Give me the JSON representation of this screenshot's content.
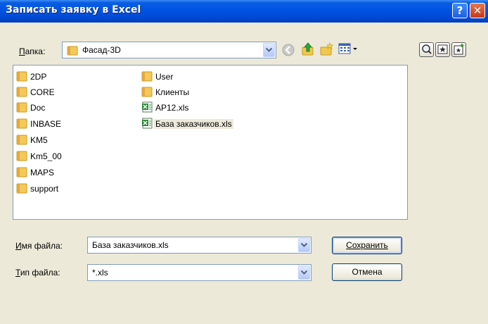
{
  "window": {
    "title": "Записать заявку в Excel",
    "help_glyph": "?",
    "close_glyph": "✕"
  },
  "toolbar": {
    "folder_label": "Папка:",
    "folder_label_accel": "П",
    "folder_label_rest": "апка:",
    "current_folder": "Фасад-3D",
    "icons": [
      "back-icon",
      "up-folder-icon",
      "new-folder-icon",
      "view-menu-icon"
    ]
  },
  "right_buttons": [
    "find-icon",
    "favorites-icon",
    "add-favorite-icon"
  ],
  "files": [
    {
      "name": "2DP",
      "type": "folder"
    },
    {
      "name": "CORE",
      "type": "folder"
    },
    {
      "name": "Doc",
      "type": "folder"
    },
    {
      "name": "INBASE",
      "type": "folder"
    },
    {
      "name": "KM5",
      "type": "folder"
    },
    {
      "name": "Km5_00",
      "type": "folder"
    },
    {
      "name": "MAPS",
      "type": "folder"
    },
    {
      "name": "support",
      "type": "folder"
    },
    {
      "name": "User",
      "type": "folder"
    },
    {
      "name": "Клиенты",
      "type": "folder"
    },
    {
      "name": "AP12.xls",
      "type": "excel"
    },
    {
      "name": "База заказчиков.xls",
      "type": "excel",
      "selected": true
    }
  ],
  "filename": {
    "label_accel": "И",
    "label_rest": "мя файла:",
    "value": "База заказчиков.xls"
  },
  "filetype": {
    "label_accel": "Т",
    "label_rest": "ип файла:",
    "value": "*.xls"
  },
  "buttons": {
    "save_label": "Сохранить",
    "cancel_label": "Отмена"
  },
  "colors": {
    "titlebar": "#0055e5",
    "dialog_bg": "#ece9d8",
    "folder": "#f4c95a",
    "excel": "#2f8a3a"
  }
}
